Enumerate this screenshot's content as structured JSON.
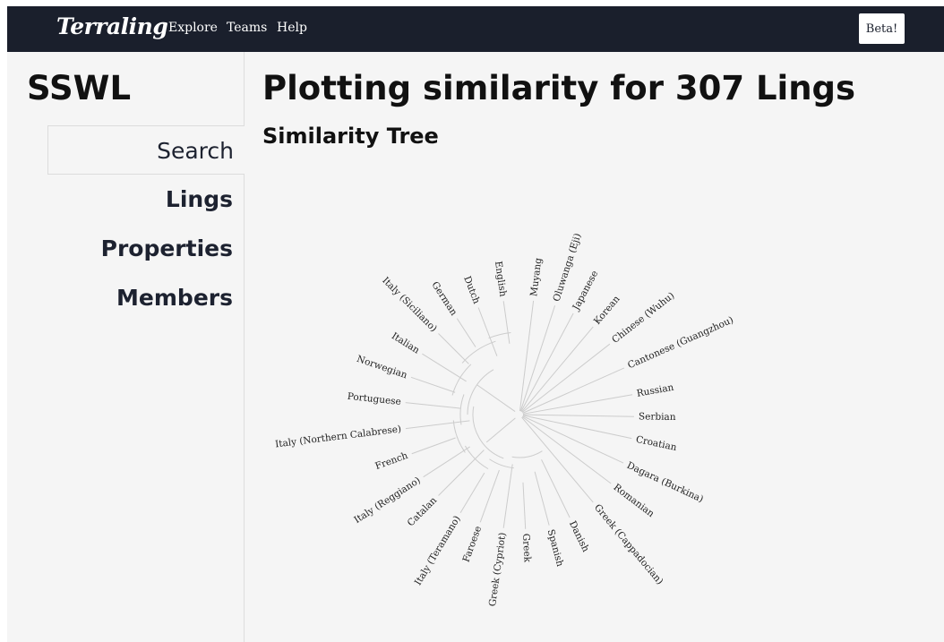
{
  "header": {
    "brand": "Terraling",
    "nav": [
      "Explore",
      "Teams",
      "Help"
    ],
    "beta_label": "Beta!"
  },
  "sidebar": {
    "title": "SSWL",
    "items": [
      {
        "label": "Search",
        "active": true
      },
      {
        "label": "Lings",
        "active": false
      },
      {
        "label": "Properties",
        "active": false
      },
      {
        "label": "Members",
        "active": false
      }
    ]
  },
  "main": {
    "title": "Plotting similarity for 307 Lings",
    "subtitle": "Similarity Tree"
  },
  "tree": {
    "leaves": [
      {
        "name": "Muyang",
        "angle": -83
      },
      {
        "name": "Oluwanga (Eji)",
        "angle": -72
      },
      {
        "name": "Japanese",
        "angle": -62
      },
      {
        "name": "Korean",
        "angle": -50
      },
      {
        "name": "Chinese (Wuhu)",
        "angle": -38
      },
      {
        "name": "Cantonese (Guangzhou)",
        "angle": -24
      },
      {
        "name": "Russian",
        "angle": -10
      },
      {
        "name": "Serbian",
        "angle": 1
      },
      {
        "name": "Croatian",
        "angle": 12
      },
      {
        "name": "Dagara (Burkina)",
        "angle": 25
      },
      {
        "name": "Romanian",
        "angle": 37
      },
      {
        "name": "Greek (Cappadocian)",
        "angle": 50
      },
      {
        "name": "Danish",
        "angle": 64
      },
      {
        "name": "Spanish",
        "angle": 75
      },
      {
        "name": "Greek",
        "angle": 87
      },
      {
        "name": "Greek (Cypriot)",
        "angle": 98
      },
      {
        "name": "Faroese",
        "angle": 110
      },
      {
        "name": "Italy (Teramano)",
        "angle": 121
      },
      {
        "name": "Catalan",
        "angle": 135
      },
      {
        "name": "Italy (Reggiano)",
        "angle": 147
      },
      {
        "name": "French",
        "angle": 160
      },
      {
        "name": "Italy (Northern Calabrese)",
        "angle": 173
      },
      {
        "name": "Portuguese",
        "angle": 186
      },
      {
        "name": "Norwegian",
        "angle": 199
      },
      {
        "name": "Italian",
        "angle": 212
      },
      {
        "name": "Italy (Siciliano)",
        "angle": 225
      },
      {
        "name": "German",
        "angle": 237
      },
      {
        "name": "Dutch",
        "angle": 249
      },
      {
        "name": "English",
        "angle": 262
      }
    ]
  },
  "colors": {
    "topbar": "#1a1f2c",
    "background": "#f5f5f5",
    "link_line": "#cccccc",
    "label": "#222222"
  }
}
